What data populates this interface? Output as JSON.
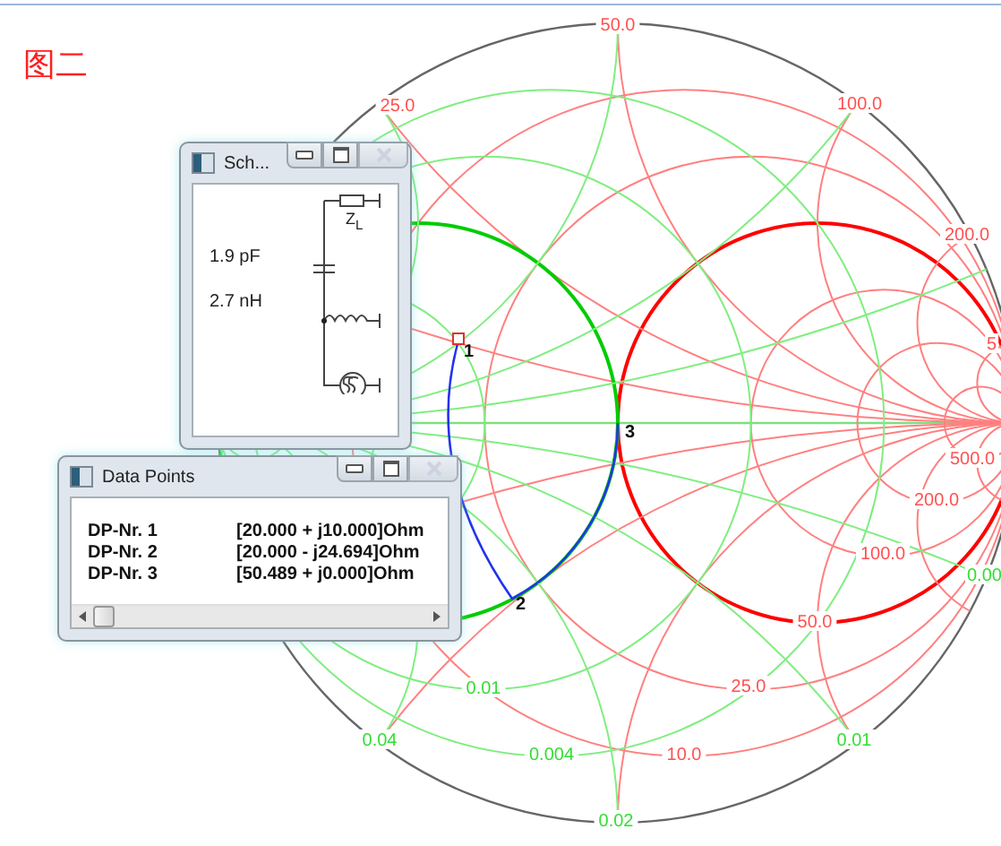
{
  "figure_caption": "图二",
  "chart_labels": [
    {
      "text": "25.0",
      "kind": "resistance"
    },
    {
      "text": "50.0",
      "kind": "resistance"
    },
    {
      "text": "100.0",
      "kind": "resistance"
    },
    {
      "text": "200.0",
      "kind": "resistance"
    },
    {
      "text": "5",
      "kind": "resistance"
    },
    {
      "text": "500.0",
      "kind": "resistance"
    },
    {
      "text": "200.0",
      "kind": "resistance"
    },
    {
      "text": "100.0",
      "kind": "resistance"
    },
    {
      "text": "50.0",
      "kind": "resistance"
    },
    {
      "text": "25.0",
      "kind": "resistance"
    },
    {
      "text": "10.0",
      "kind": "resistance"
    },
    {
      "text": "0.00",
      "kind": "conductance"
    },
    {
      "text": "0.01",
      "kind": "conductance"
    },
    {
      "text": "0.004",
      "kind": "conductance"
    },
    {
      "text": "0.02",
      "kind": "conductance"
    },
    {
      "text": "0.01",
      "kind": "conductance"
    },
    {
      "text": "0.04",
      "kind": "conductance"
    }
  ],
  "points": [
    {
      "label": "1"
    },
    {
      "label": "2"
    },
    {
      "label": "3"
    }
  ],
  "schematic_window": {
    "title": "Sch...",
    "load_label": "Z$_{L}$",
    "components": [
      {
        "value": "1.9 pF"
      },
      {
        "value": "2.7 nH"
      }
    ]
  },
  "data_window": {
    "title": "Data Points",
    "rows": [
      {
        "name": "DP-Nr. 1",
        "value": "[20.000 + j10.000]Ohm"
      },
      {
        "name": "DP-Nr. 2",
        "value": "[20.000 - j24.694]Ohm"
      },
      {
        "name": "DP-Nr. 3",
        "value": "[50.489 + j0.000]Ohm"
      }
    ]
  }
}
